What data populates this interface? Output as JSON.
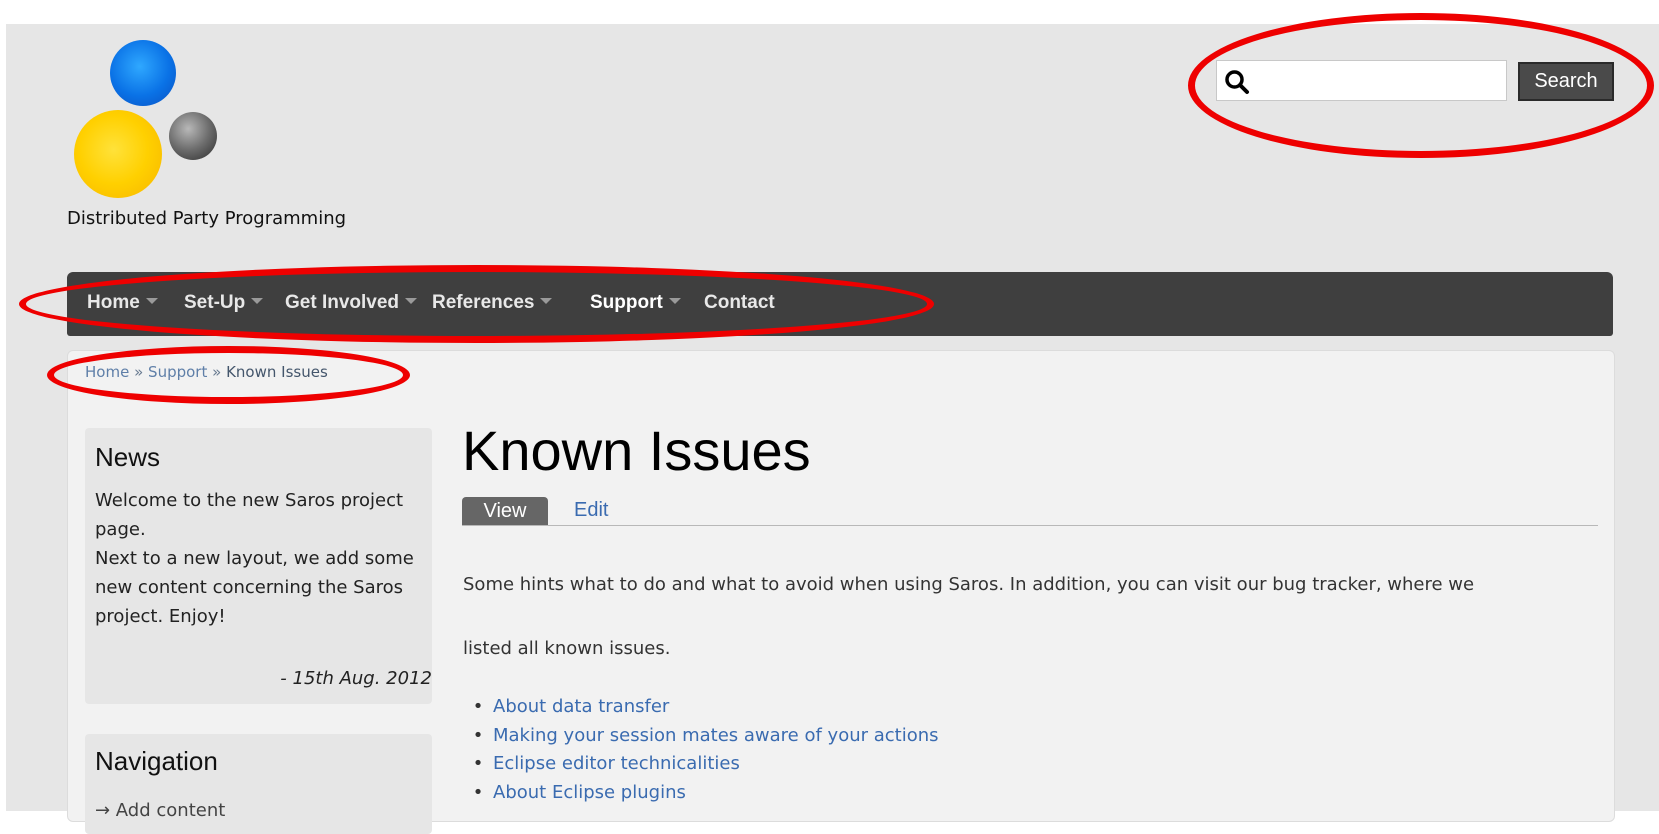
{
  "site": {
    "slogan": "Distributed Party Programming",
    "logo_colors": {
      "blue": "#0a72e6",
      "yellow": "#ffd000",
      "gray": "#6c6c6c"
    }
  },
  "search": {
    "icon": "search-icon",
    "placeholder": "",
    "value": "",
    "button_label": "Search"
  },
  "nav": {
    "items": [
      {
        "label": "Home",
        "has_dropdown": true
      },
      {
        "label": "Set-Up",
        "has_dropdown": true
      },
      {
        "label": "Get Involved",
        "has_dropdown": true
      },
      {
        "label": "References",
        "has_dropdown": true
      },
      {
        "label": "Support",
        "has_dropdown": true,
        "active": true
      },
      {
        "label": "Contact",
        "has_dropdown": false
      }
    ],
    "background": "#3f3f3f"
  },
  "breadcrumb": {
    "items": [
      "Home",
      "Support",
      "Known Issues"
    ],
    "separator": "»"
  },
  "sidebar": {
    "news": {
      "title": "News",
      "paragraph1": "Welcome to the new Saros project page.",
      "paragraph2": "Next to a new layout, we add some new content concerning the Saros project. Enjoy!",
      "date": "- 15th Aug. 2012"
    },
    "navigation": {
      "title": "Navigation",
      "items": [
        "→ Add content"
      ]
    }
  },
  "content": {
    "title": "Known Issues",
    "tabs": [
      {
        "label": "View",
        "active": true
      },
      {
        "label": "Edit",
        "active": false
      }
    ],
    "intro_line1": "Some hints what to do and what to avoid when using Saros. In addition, you can visit our bug tracker, where we",
    "intro_line2": "listed all known issues.",
    "issues": [
      "About data transfer",
      "Making your session mates aware of your actions",
      "Eclipse editor technicalities",
      "About Eclipse plugins"
    ],
    "link_color": "#3a6bb0"
  },
  "annotations": {
    "color": "#ee0000"
  }
}
